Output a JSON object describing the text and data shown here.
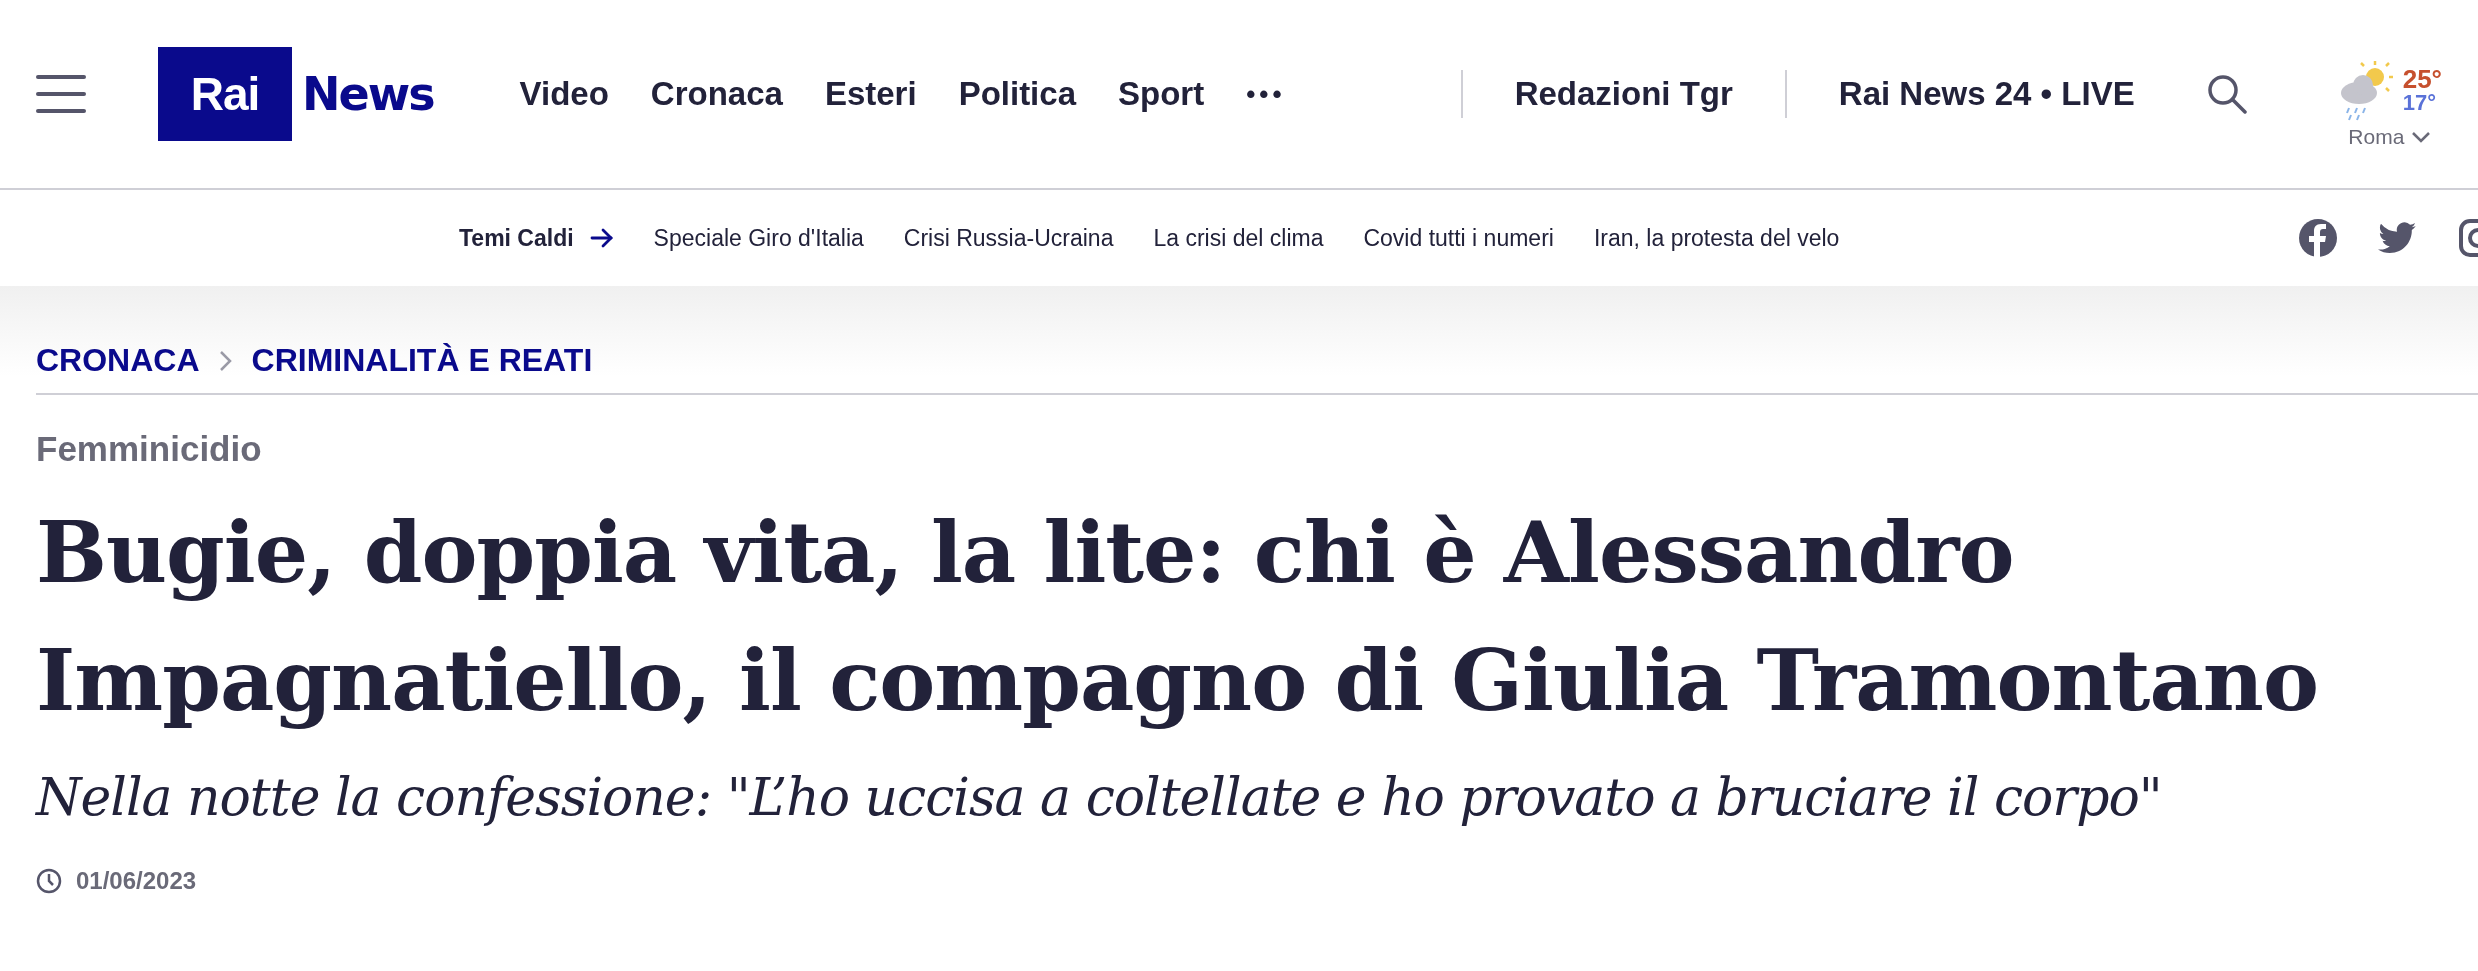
{
  "logo": {
    "part_1": "Rai",
    "part_2": "News"
  },
  "nav": [
    "Video",
    "Cronaca",
    "Esteri",
    "Politica",
    "Sport"
  ],
  "more": "•••",
  "nav_right": [
    "Redazioni Tgr",
    "Rai News 24 • LIVE"
  ],
  "weather": {
    "high": "25°",
    "low": "17°",
    "city": "Roma"
  },
  "hot_topics": {
    "label": "Temi Caldi",
    "items": [
      "Speciale Giro d'Italia",
      "Crisi Russia-Ucraina",
      "La crisi del clima",
      "Covid tutti i numeri",
      "Iran, la protesta del velo"
    ]
  },
  "breadcrumb": [
    "CRONACA",
    "CRIMINALITÀ E REATI"
  ],
  "tag": "Femminicidio",
  "headline": "Bugie, doppia vita, la lite: chi è Alessandro Impagnatiello, il compagno di Giulia Tramontano",
  "subtitle": "Nella notte la confessione: \"L’ho uccisa a coltellate e ho provato a bruciare il corpo\"",
  "date": "01/06/2023"
}
